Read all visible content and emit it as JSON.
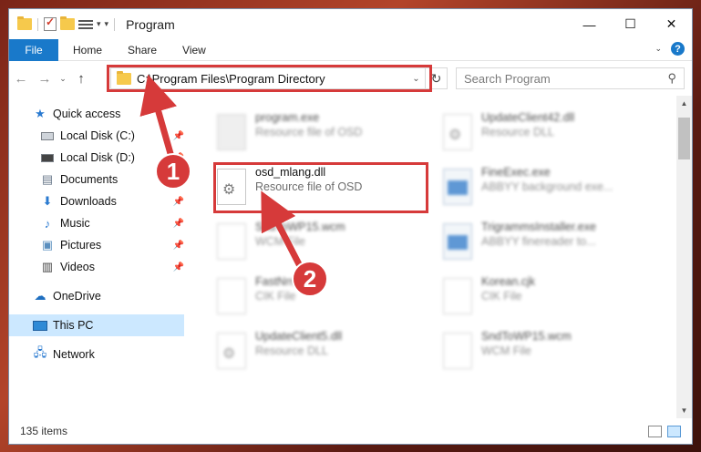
{
  "window": {
    "title": "Program"
  },
  "ribbon": {
    "tabs": [
      "File",
      "Home",
      "Share",
      "View"
    ]
  },
  "address": {
    "path": "C:\\Program Files\\Program Directory"
  },
  "search": {
    "placeholder": "Search Program"
  },
  "sidebar": {
    "quick_access": "Quick access",
    "items": [
      "Local Disk (C:)",
      "Local Disk (D:)",
      "Documents",
      "Downloads",
      "Music",
      "Pictures",
      "Videos"
    ],
    "onedrive": "OneDrive",
    "this_pc": "This PC",
    "network": "Network"
  },
  "files": {
    "col1": [
      {
        "name": "program.exe",
        "type": "Resource file of OSD"
      },
      {
        "name": "osd_mlang.dll",
        "type": "Resource file of OSD"
      },
      {
        "name": "SndToWP15.wcm",
        "type": "WCM File"
      },
      {
        "name": "FastNrm",
        "type": "CIK File"
      },
      {
        "name": "UpdateClient5.dll",
        "type": "Resource DLL"
      }
    ],
    "col2": [
      {
        "name": "UpdateClient42.dll",
        "type": "Resource DLL"
      },
      {
        "name": "FineExec.exe",
        "type": "ABBYY background exe..."
      },
      {
        "name": "TrigrammsInstaller.exe",
        "type": "ABBYY finereader to..."
      },
      {
        "name": "Korean.cjk",
        "type": "CIK File"
      },
      {
        "name": "SndToWP15.wcm",
        "type": "WCM File"
      }
    ]
  },
  "status": {
    "count": "135 items"
  },
  "annotations": {
    "step1": "1",
    "step2": "2",
    "color": "#d63a3a"
  }
}
